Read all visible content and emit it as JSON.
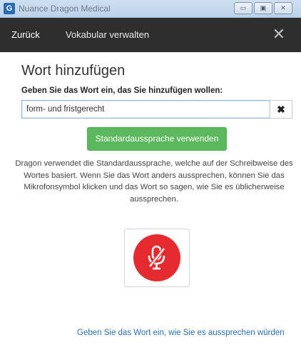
{
  "window": {
    "title": "Nuance Dragon Medical",
    "app_icon_glyph": "G",
    "buttons": [
      "minimize-icon",
      "maximize-icon",
      "close-icon"
    ],
    "button_glyphs": [
      "▭",
      "▣",
      "✕"
    ]
  },
  "nav": {
    "back_label": "Zurück",
    "title": "Vokabular verwalten",
    "close_glyph": "✕"
  },
  "page": {
    "heading": "Wort hinzufügen",
    "field_label": "Geben Sie das Wort ein, das Sie hinzufügen wollen:",
    "word_value": "form- und fristgerecht",
    "clear_glyph": "✖",
    "default_button_label": "Standardaussprache verwenden",
    "description": "Dragon verwendet die Standardaussprache, welche auf der Schreibweise des Wortes basiert. Wenn Sie das Wort anders aussprechen, können Sie das Mikrofonsymbol klicken und das Wort so sagen, wie Sie es üblicherweise aussprechen.",
    "mic_icon": "microphone-muted-icon",
    "pronounce_link": "Geben Sie das Wort ein, wie Sie es aussprechen würden"
  },
  "colors": {
    "nav_bg": "#2e2e2e",
    "primary_green": "#5cb85c",
    "mic_red": "#e52b2f",
    "link_blue": "#2a6fb0"
  }
}
